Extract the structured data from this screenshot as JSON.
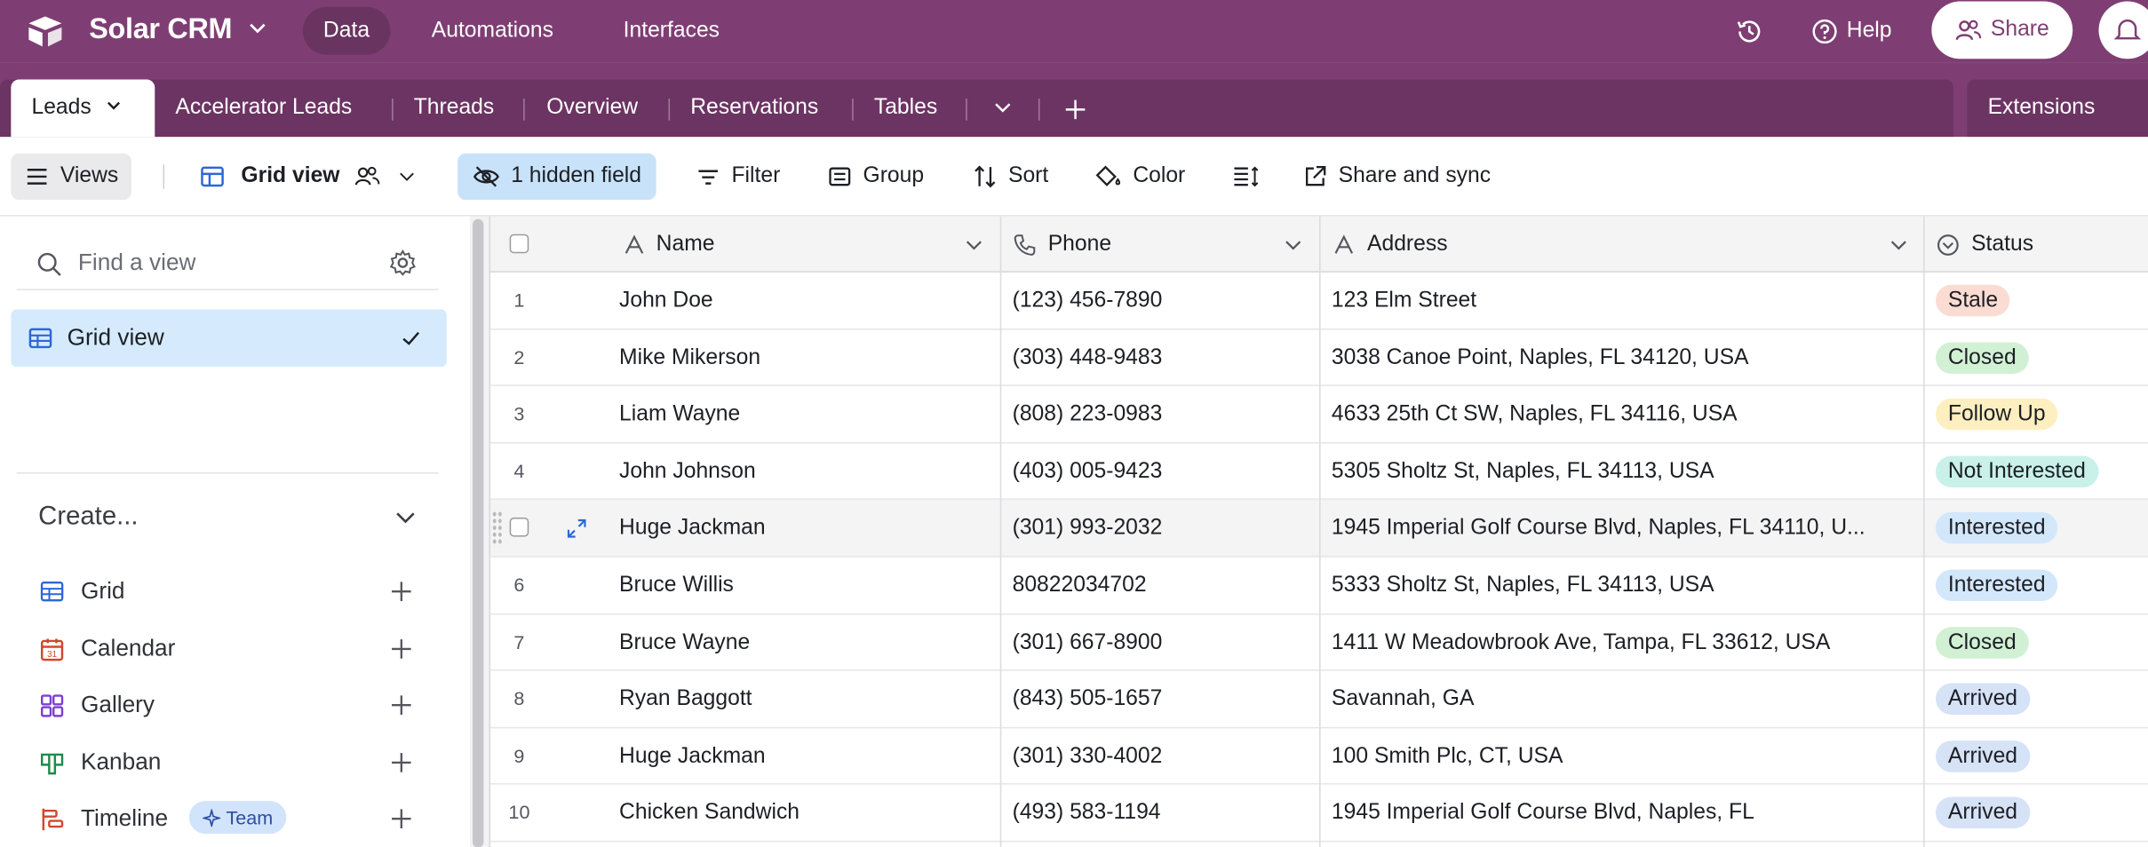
{
  "app": {
    "name": "Solar CRM"
  },
  "topnav": {
    "data": "Data",
    "automations": "Automations",
    "interfaces": "Interfaces",
    "help": "Help",
    "share": "Share"
  },
  "tabs": [
    {
      "label": "Leads"
    },
    {
      "label": "Accelerator Leads"
    },
    {
      "label": "Threads"
    },
    {
      "label": "Overview"
    },
    {
      "label": "Reservations"
    },
    {
      "label": "Tables"
    }
  ],
  "extensions": "Extensions",
  "toolbar": {
    "views": "Views",
    "grid_view": "Grid view",
    "hidden_fields": "1 hidden field",
    "filter": "Filter",
    "group": "Group",
    "sort": "Sort",
    "color": "Color",
    "share_sync": "Share and sync"
  },
  "sidebar": {
    "search_placeholder": "Find a view",
    "active_view": "Grid view",
    "create_title": "Create...",
    "create_items": [
      {
        "label": "Grid",
        "icon": "grid-icon"
      },
      {
        "label": "Calendar",
        "icon": "calendar-icon"
      },
      {
        "label": "Gallery",
        "icon": "gallery-icon"
      },
      {
        "label": "Kanban",
        "icon": "kanban-icon"
      },
      {
        "label": "Timeline",
        "icon": "timeline-icon",
        "badge": "Team"
      }
    ]
  },
  "columns": {
    "name": "Name",
    "phone": "Phone",
    "address": "Address",
    "status": "Status"
  },
  "status_colors": {
    "Stale": "#fbdcd3",
    "Closed": "#d1f0d4",
    "Follow Up": "#fdefc0",
    "Not Interested": "#c9f1ea",
    "Interested": "#d3e7fb",
    "Arrived": "#d6e2f6"
  },
  "rows": [
    {
      "num": "1",
      "name": "John Doe",
      "phone": "(123) 456-7890",
      "address": "123 Elm Street",
      "status": "Stale"
    },
    {
      "num": "2",
      "name": "Mike Mikerson",
      "phone": "(303) 448-9483",
      "address": "3038 Canoe Point, Naples, FL 34120, USA",
      "status": "Closed"
    },
    {
      "num": "3",
      "name": "Liam Wayne",
      "phone": "(808) 223-0983",
      "address": "4633 25th Ct SW, Naples, FL 34116, USA",
      "status": "Follow Up"
    },
    {
      "num": "4",
      "name": "John Johnson",
      "phone": "(403) 005-9423",
      "address": "5305 Sholtz St, Naples, FL 34113, USA",
      "status": "Not Interested"
    },
    {
      "num": "",
      "name": "Huge Jackman",
      "phone": "(301) 993-2032",
      "address": "1945 Imperial Golf Course Blvd, Naples, FL 34110, U...",
      "status": "Interested"
    },
    {
      "num": "6",
      "name": "Bruce Willis",
      "phone": "80822034702",
      "address": "5333 Sholtz St, Naples, FL 34113, USA",
      "status": "Interested"
    },
    {
      "num": "7",
      "name": "Bruce Wayne",
      "phone": "(301) 667-8900",
      "address": "1411 W Meadowbrook Ave, Tampa, FL 33612, USA",
      "status": "Closed"
    },
    {
      "num": "8",
      "name": "Ryan Baggott",
      "phone": "(843) 505-1657",
      "address": "Savannah, GA",
      "status": "Arrived"
    },
    {
      "num": "9",
      "name": "Huge Jackman",
      "phone": "(301) 330-4002",
      "address": "100 Smith Plc, CT, USA",
      "status": "Arrived"
    },
    {
      "num": "10",
      "name": "Chicken Sandwich",
      "phone": "(493) 583-1194",
      "address": "1945 Imperial Golf Course Blvd, Naples, FL",
      "status": "Arrived"
    }
  ]
}
